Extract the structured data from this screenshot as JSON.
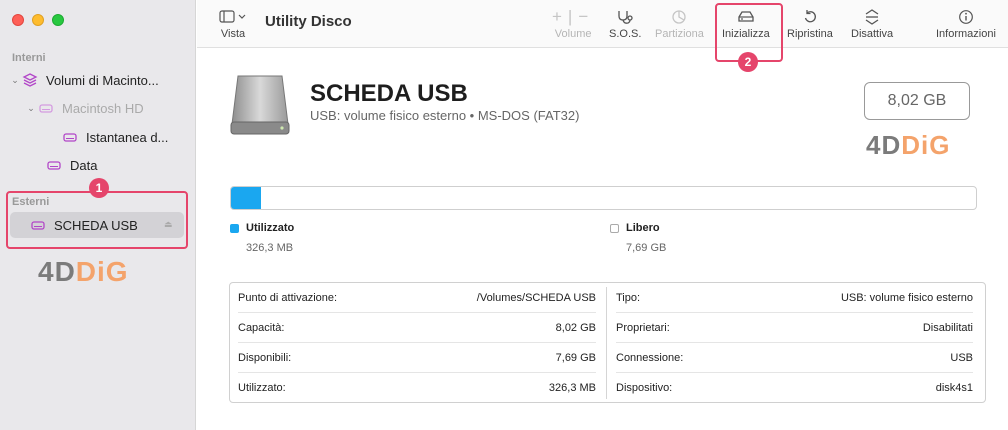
{
  "sidebar": {
    "internal_label": "Interni",
    "external_label": "Esterni",
    "items": [
      {
        "label": "Volumi di Macinto..."
      },
      {
        "label": "Macintosh HD"
      },
      {
        "label": "Istantanea d..."
      },
      {
        "label": "Data"
      },
      {
        "label": "SCHEDA USB"
      }
    ],
    "badge1": "1",
    "brand_part1": "4D",
    "brand_part2": "DiG"
  },
  "toolbar": {
    "title": "Utility Disco",
    "view_label": "Vista",
    "volume_label": "Volume",
    "sos_label": "S.O.S.",
    "partition_label": "Partiziona",
    "erase_label": "Inizializza",
    "restore_label": "Ripristina",
    "unmount_label": "Disattiva",
    "info_label": "Informazioni",
    "badge2": "2"
  },
  "disk": {
    "name": "SCHEDA USB",
    "subtitle": "USB: volume fisico esterno • MS-DOS (FAT32)",
    "size": "8,02 GB",
    "brand_part1": "4D",
    "brand_part2": "DiG"
  },
  "usage": {
    "used_fraction": 0.04,
    "used_label": "Utilizzato",
    "used_value": "326,3 MB",
    "free_label": "Libero",
    "free_value": "7,69 GB",
    "used_color": "#1aa7f0"
  },
  "info_left": [
    {
      "k": "Punto di attivazione:",
      "v": "/Volumes/SCHEDA USB"
    },
    {
      "k": "Capacità:",
      "v": "8,02 GB"
    },
    {
      "k": "Disponibili:",
      "v": "7,69 GB"
    },
    {
      "k": "Utilizzato:",
      "v": "326,3 MB"
    }
  ],
  "info_right": [
    {
      "k": "Tipo:",
      "v": "USB: volume fisico esterno"
    },
    {
      "k": "Proprietari:",
      "v": "Disabilitati"
    },
    {
      "k": "Connessione:",
      "v": "USB"
    },
    {
      "k": "Dispositivo:",
      "v": "disk4s1"
    }
  ],
  "colors": {
    "highlight": "#e5456b",
    "accent": "#1aa7f0"
  }
}
